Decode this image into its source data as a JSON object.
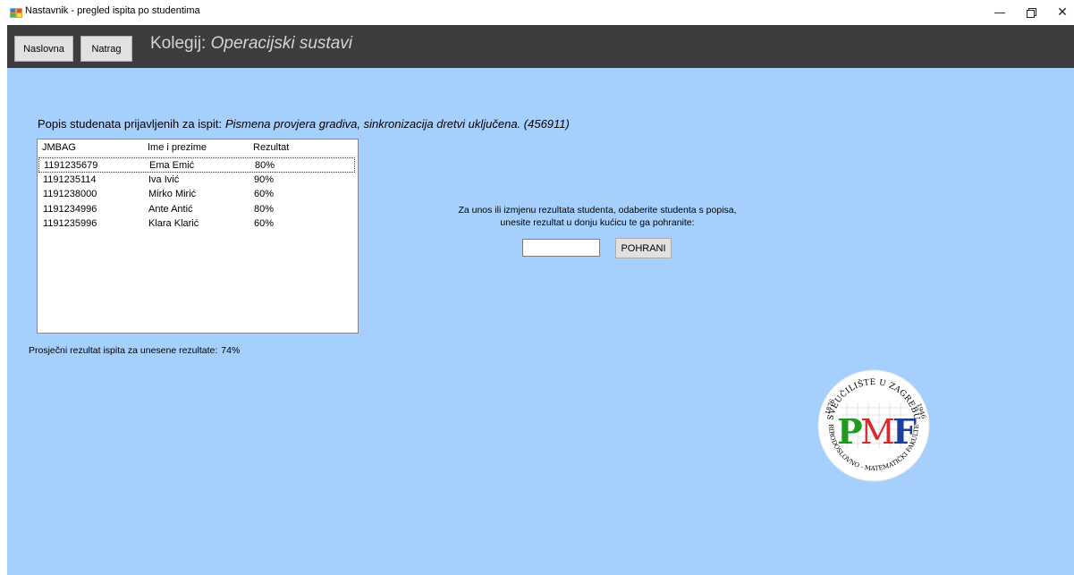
{
  "window": {
    "title": "Nastavnik - pregled ispita po studentima",
    "minimize_glyph": "—",
    "maximize_glyph": "❐",
    "close_glyph": "✕"
  },
  "header": {
    "home_button": "Naslovna",
    "back_button": "Natrag",
    "course_prefix": "Kolegij:",
    "course_name": "Operacijski sustavi"
  },
  "exam": {
    "list_label": "Popis studenata prijavljenih za ispit:",
    "exam_name": "Pismena provjera gradiva, sinkronizacija dretvi uključena. (456911)"
  },
  "students_table": {
    "columns": [
      "JMBAG",
      "Ime i prezime",
      "Rezultat"
    ],
    "rows": [
      [
        "1191235679",
        "Ema Emić",
        "80%"
      ],
      [
        "1191235114",
        "Iva Ivić",
        "90%"
      ],
      [
        "1191238000",
        "Mirko Mirić",
        "60%"
      ],
      [
        "1191234996",
        "Ante Antić",
        "80%"
      ],
      [
        "1191235996",
        "Klara Klarić",
        "60%"
      ]
    ],
    "focused_row": 0
  },
  "average": {
    "label": "Prosječni rezultat ispita za unesene rezultate:",
    "value": "74%"
  },
  "entry": {
    "instruction_line1": "Za unos ili izmjenu rezultata studenta, odaberite studenta s popisa,",
    "instruction_line2": "unesite rezultat u donju kućicu te ga pohranite:",
    "input_value": "",
    "save_button": "POHRANI"
  },
  "logo": {
    "text_top": "SVEUČILIŠTE U ZAGREBU",
    "text_bottom": "PRIRODOSLOVNO - MATEMATIČKI FAKULTET",
    "letters": "PMF",
    "year_left": "1876",
    "year_right": "1946"
  },
  "colors": {
    "main_background": "#a5cffd",
    "header_background": "#3d3d3d",
    "logo_green": "#1e9a1e",
    "logo_blue": "#1d3f9c",
    "logo_red": "#d62b2b"
  }
}
